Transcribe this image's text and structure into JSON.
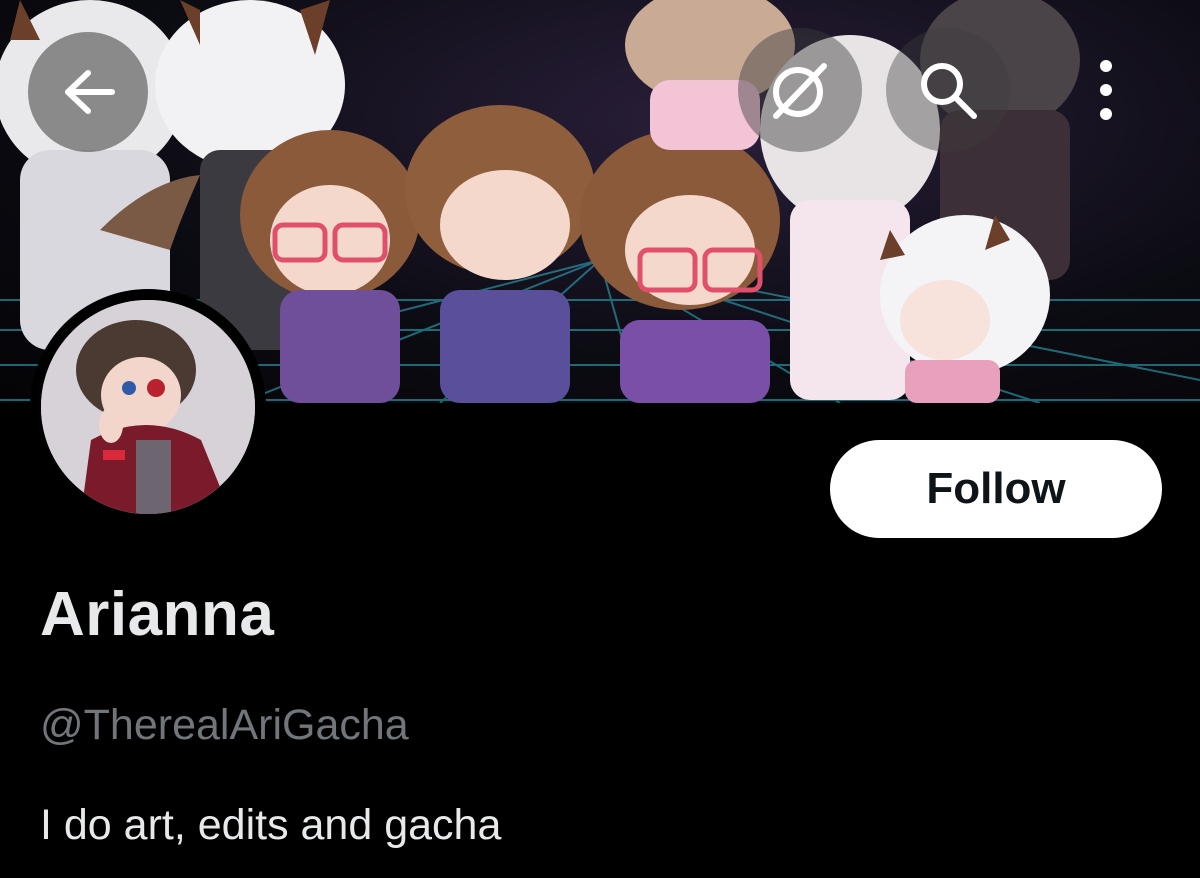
{
  "header": {
    "back_icon": "arrow-left-icon",
    "grok_icon": "grok-icon",
    "search_icon": "search-icon",
    "more_icon": "more-vertical-icon"
  },
  "profile": {
    "display_name": "Arianna",
    "handle": "@TherealAriGacha",
    "bio": "I do art, edits and gacha",
    "follow_label": "Follow"
  },
  "colors": {
    "background": "#000000",
    "primary_text": "#e7e9ea",
    "secondary_text": "#71767b",
    "follow_bg": "#ffffff",
    "follow_text": "#0f1419"
  }
}
